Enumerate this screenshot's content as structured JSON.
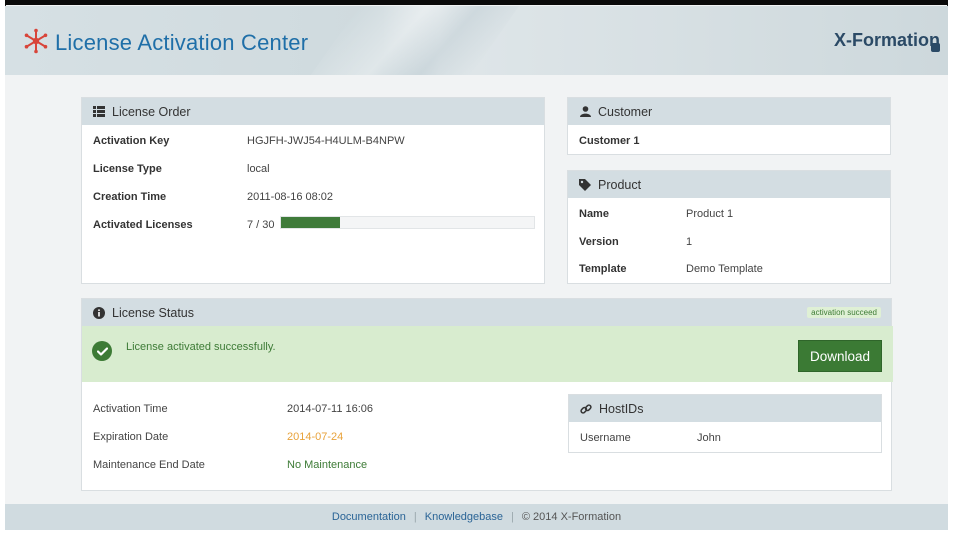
{
  "header": {
    "title": "License Activation Center",
    "brand_right": "X-Formation"
  },
  "license_order": {
    "title": "License Order",
    "rows": [
      {
        "label": "Activation Key",
        "value": "HGJFH-JWJ54-H4ULM-B4NPW"
      },
      {
        "label": "License Type",
        "value": "local"
      },
      {
        "label": "Creation Time",
        "value": "2011-08-16 08:02"
      },
      {
        "label": "Activated Licenses",
        "value": "7 / 30"
      }
    ],
    "progress_fraction": 0.233
  },
  "customer": {
    "title": "Customer",
    "name": "Customer 1"
  },
  "product": {
    "title": "Product",
    "rows": [
      {
        "label": "Name",
        "value": "Product 1"
      },
      {
        "label": "Version",
        "value": "1"
      },
      {
        "label": "Template",
        "value": "Demo Template"
      }
    ]
  },
  "license_status": {
    "title": "License Status",
    "badge": "activation succeed",
    "message": "License activated successfully.",
    "download_label": "Download",
    "rows": [
      {
        "label": "Activation Time",
        "value": "2014-07-11 16:06",
        "color": "#444444"
      },
      {
        "label": "Expiration Date",
        "value": "2014-07-24",
        "color": "#e8a23a"
      },
      {
        "label": "Maintenance End Date",
        "value": "No Maintenance",
        "color": "#3d7b36"
      }
    ]
  },
  "hostids": {
    "title": "HostIDs",
    "rows": [
      {
        "label": "Username",
        "value": "John"
      }
    ]
  },
  "footer": {
    "documentation": "Documentation",
    "knowledgebase": "Knowledgebase",
    "copyright": "© 2014 X-Formation"
  },
  "colors": {
    "accent_blue": "#1f6fa8",
    "success_green": "#3d7b36",
    "brand_dark": "#2b4a66",
    "warning_orange": "#e8a23a"
  },
  "icons": {
    "logo": "asterisk-network-logo-icon",
    "license_order": "list-icon",
    "customer": "user-icon",
    "product": "tag-icon",
    "license_status": "info-circle-icon",
    "success": "check-circle-icon",
    "hostids": "link-icon",
    "brand_lock": "lock-icon"
  }
}
